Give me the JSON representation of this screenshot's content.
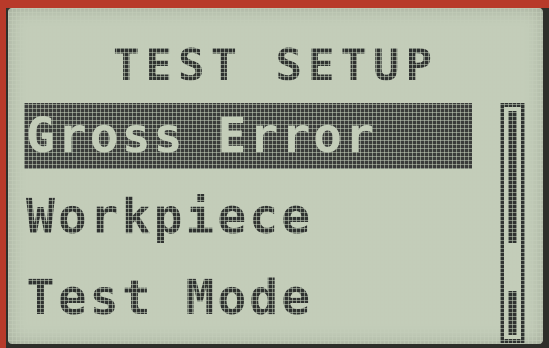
{
  "screen": {
    "title": "TEST SETUP"
  },
  "menu": {
    "items": [
      {
        "label": "Gross Error",
        "selected": true
      },
      {
        "label": "Workpiece",
        "selected": false
      },
      {
        "label": "Test Mode",
        "selected": false
      }
    ]
  },
  "scrollbar": {
    "position_fraction": 0.0
  },
  "colors": {
    "lcd_background": "#c3cdb9",
    "pixel_dark": "#2f3230",
    "highlight_bar": "#3a3c3a"
  }
}
